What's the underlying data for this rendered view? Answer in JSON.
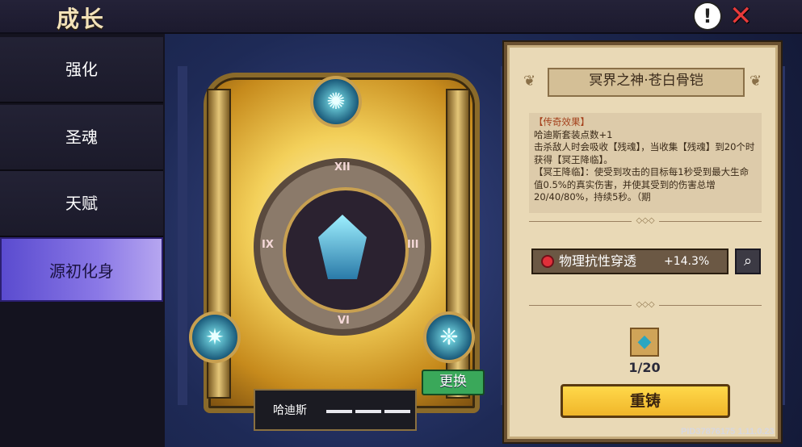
{
  "header": {
    "title": "成长",
    "help_icon": "!",
    "close_icon": "✕"
  },
  "sidebar": {
    "tabs": [
      {
        "label": "强化",
        "active": false
      },
      {
        "label": "圣魂",
        "active": false
      },
      {
        "label": "天赋",
        "active": false
      },
      {
        "label": "源初化身",
        "active": true
      }
    ]
  },
  "center": {
    "dial_numerals": [
      "XII",
      "III",
      "VI",
      "IX"
    ],
    "swap_label": "更换",
    "hero_name": "哈迪斯",
    "orb_icons": [
      "spider-emblem-icon",
      "spider-armor-icon",
      "web-sigil-icon",
      "bone-beast-icon"
    ]
  },
  "panel": {
    "title": "冥界之神·苍白骨铠",
    "effect": {
      "header": "【传奇效果】",
      "lines": [
        "哈迪斯套装点数+1",
        "击杀敌人时会吸收【残魂】，当收集【残魂】到20个时获得【冥王降临】。",
        "【冥王降临】：使受到攻击的目标每1秒受到最大生命值0.5%的真实伤害，并使其受到的伤害总增20/40/80%，持续5秒。（期"
      ]
    },
    "stat": {
      "label": "物理抗性穿透",
      "value": "+14.3%"
    },
    "material_count": "1/20",
    "reforge_label": "重铸"
  },
  "footer": {
    "build_id": "PID37876175 1.11.0.23"
  },
  "colors": {
    "accent": "#ffd84a",
    "active_tab": "#8a78e6",
    "swap_button": "#3aa85a"
  }
}
